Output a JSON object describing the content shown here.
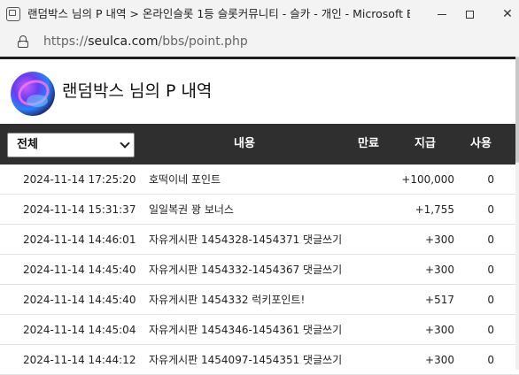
{
  "window": {
    "title": "랜덤박스 님의 P 내역 > 온라인슬롯 1등 슬롯커뮤니티 - 슬카 - 개인 - Microsoft E...",
    "minimize_label": "",
    "close_label": "✕"
  },
  "addressbar": {
    "url_scheme": "https://",
    "url_host": "seulca.com",
    "url_path": "/bbs/point.php"
  },
  "header": {
    "title": "랜덤박스 님의 P 내역"
  },
  "table": {
    "filter_value": "전체",
    "columns": {
      "content": "내용",
      "expire": "만료",
      "paid": "지급",
      "used": "사용"
    },
    "rows": [
      {
        "date": "2024-11-14 17:25:20",
        "desc": "호떡이네 포인트",
        "paid": "+100,000",
        "used": "0"
      },
      {
        "date": "2024-11-14 15:31:37",
        "desc": "일일복권 꽝 보너스",
        "paid": "+1,755",
        "used": "0"
      },
      {
        "date": "2024-11-14 14:46:01",
        "desc": "자유게시판 1454328-1454371 댓글쓰기",
        "paid": "+300",
        "used": "0"
      },
      {
        "date": "2024-11-14 14:45:40",
        "desc": "자유게시판 1454332-1454367 댓글쓰기",
        "paid": "+300",
        "used": "0"
      },
      {
        "date": "2024-11-14 14:45:40",
        "desc": "자유게시판 1454332 럭키포인트!",
        "paid": "+517",
        "used": "0"
      },
      {
        "date": "2024-11-14 14:45:04",
        "desc": "자유게시판 1454346-1454361 댓글쓰기",
        "paid": "+300",
        "used": "0"
      },
      {
        "date": "2024-11-14 14:44:12",
        "desc": "자유게시판 1454097-1454351 댓글쓰기",
        "paid": "+300",
        "used": "0"
      }
    ]
  },
  "icons": [
    "app-icon",
    "minimize-icon",
    "maximize-icon",
    "close-icon",
    "lock-icon",
    "chevron-down-icon"
  ]
}
